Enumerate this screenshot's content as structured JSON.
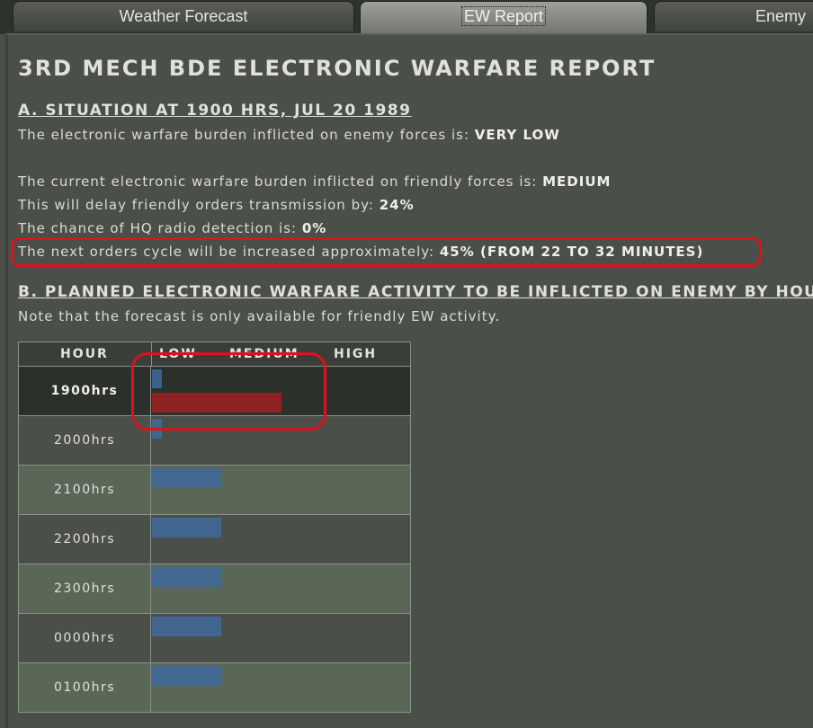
{
  "tabs": [
    {
      "label": "Weather Forecast",
      "active": false
    },
    {
      "label": "EW Report",
      "active": true
    },
    {
      "label": "Enemy",
      "active": false
    }
  ],
  "report": {
    "title": "3RD MECH BDE ELECTRONIC WARFARE REPORT",
    "section_a": {
      "heading": "A. SITUATION AT 1900 HRS, JUL 20 1989",
      "enemy_burden_text": "The electronic warfare burden inflicted on enemy forces is: ",
      "enemy_burden_value": "VERY LOW",
      "friendly_burden_text": "The current electronic warfare burden inflicted on friendly forces is: ",
      "friendly_burden_value": "MEDIUM",
      "delay_text": "This will delay friendly orders transmission by: ",
      "delay_value": "24%",
      "detection_text": "The chance of HQ radio detection is: ",
      "detection_value": "0%",
      "cycle_text": "The next orders cycle will be increased approximately: ",
      "cycle_value": "45% (FROM 22 TO 32 MINUTES)"
    },
    "section_b": {
      "heading": "B. PLANNED ELECTRONIC WARFARE ACTIVITY TO BE INFLICTED ON ENEMY BY HOUR",
      "note": "Note that the forecast is only available for friendly EW activity."
    }
  },
  "table": {
    "header_hour": "HOUR",
    "header_low": "LOW",
    "header_medium": "MEDIUM",
    "header_high": "HIGH",
    "rows": [
      {
        "hour": "1900hrs",
        "friendly_level": 0.04,
        "enemy_level": 0.5
      },
      {
        "hour": "2000hrs",
        "friendly_level": 0.04,
        "enemy_level": null
      },
      {
        "hour": "2100hrs",
        "friendly_level": 0.27,
        "enemy_level": null
      },
      {
        "hour": "2200hrs",
        "friendly_level": 0.27,
        "enemy_level": null
      },
      {
        "hour": "2300hrs",
        "friendly_level": 0.27,
        "enemy_level": null
      },
      {
        "hour": "0000hrs",
        "friendly_level": 0.27,
        "enemy_level": null
      },
      {
        "hour": "0100hrs",
        "friendly_level": 0.27,
        "enemy_level": null
      }
    ]
  },
  "colors": {
    "friendly_bar": "#3f6a9c",
    "enemy_bar": "#8e2222",
    "annotation_ring": "#d8141c",
    "row_bg_dark": "#2c302a",
    "row_bg_mid": "#4b4f49",
    "row_bg_green": "#5a6757"
  }
}
